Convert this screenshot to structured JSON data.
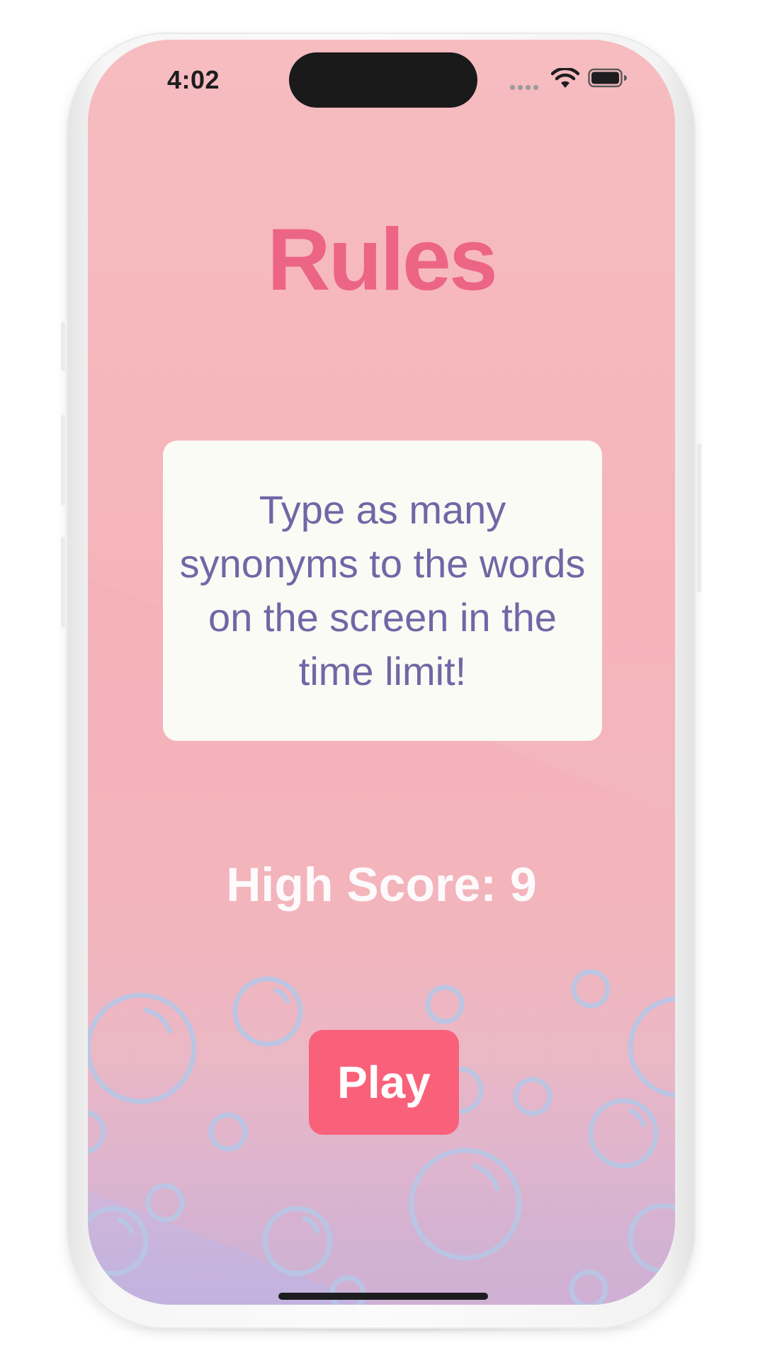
{
  "status_bar": {
    "time": "4:02",
    "wifi_icon": "wifi-icon",
    "battery_icon": "battery-icon"
  },
  "screen": {
    "title": "Rules",
    "rules_text": "Type as many synonyms to the words on the screen in the time limit!",
    "high_score": "High Score: 9",
    "play_label": "Play"
  },
  "colors": {
    "title": "#ec6584",
    "rules_text": "#6f67a6",
    "card_background": "#f9fbf4",
    "play_button": "#f9617a",
    "background_top": "#f6bcc0",
    "background_bottom": "#c3b2df",
    "bubbles": "#b7c7e6"
  }
}
